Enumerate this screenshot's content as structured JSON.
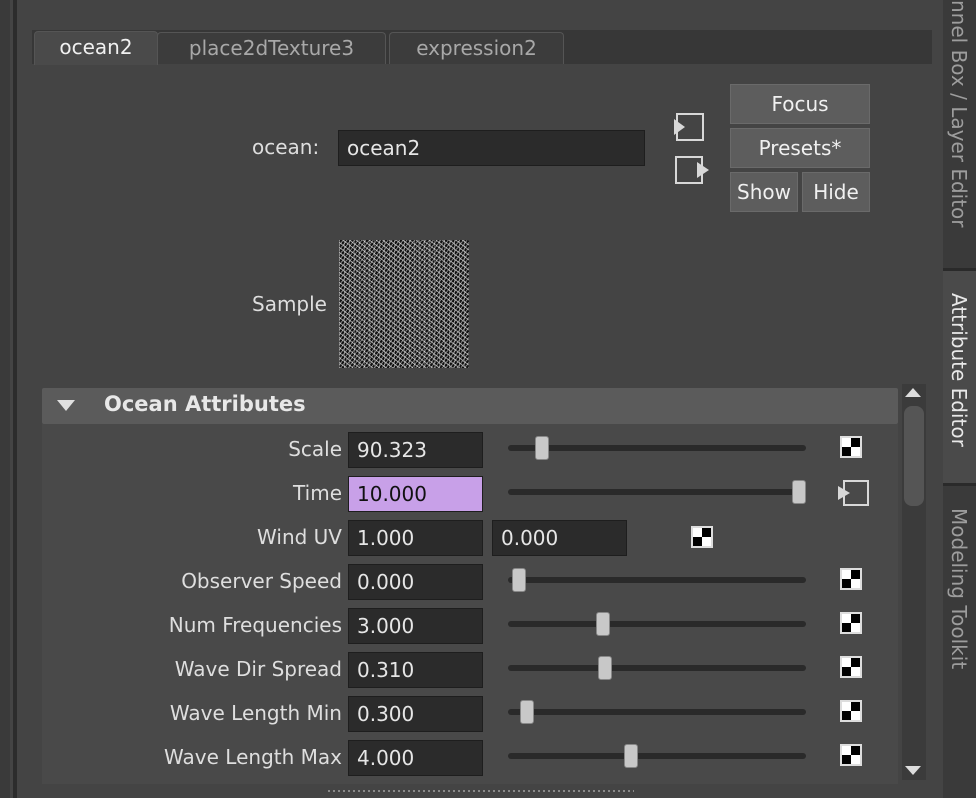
{
  "tabs": [
    {
      "label": "ocean2",
      "active": true
    },
    {
      "label": "place2dTexture3",
      "active": false
    },
    {
      "label": "expression2",
      "active": false
    }
  ],
  "node": {
    "type_label": "ocean:",
    "name_value": "ocean2"
  },
  "buttons": {
    "focus": "Focus",
    "presets": "Presets*",
    "show": "Show",
    "hide": "Hide"
  },
  "sample_label": "Sample",
  "section": {
    "title": "Ocean Attributes",
    "expanded": true
  },
  "attributes": [
    {
      "label": "Scale",
      "value": "90.323",
      "slider_fraction": 0.12,
      "map_icon": "checker-icon"
    },
    {
      "label": "Time",
      "value": "10.000",
      "slider_fraction": 0.98,
      "map_icon": "connected-input-icon",
      "highlight": "#c8a0e8"
    },
    {
      "label": "Wind UV",
      "value": "1.000",
      "value2": "0.000",
      "map_icon": "checker-icon"
    },
    {
      "label": "Observer Speed",
      "value": "0.000",
      "slider_fraction": 0.02,
      "map_icon": "checker-icon"
    },
    {
      "label": "Num Frequencies",
      "value": "3.000",
      "slider_fraction": 0.32,
      "map_icon": "checker-icon"
    },
    {
      "label": "Wave Dir Spread",
      "value": "0.310",
      "slider_fraction": 0.33,
      "map_icon": "checker-icon"
    },
    {
      "label": "Wave Length Min",
      "value": "0.300",
      "slider_fraction": 0.06,
      "map_icon": "checker-icon"
    },
    {
      "label": "Wave Length Max",
      "value": "4.000",
      "slider_fraction": 0.41,
      "map_icon": "checker-icon"
    }
  ],
  "dock_tabs": [
    {
      "label": "nnel Box / Layer Editor",
      "active": false
    },
    {
      "label": "Attribute Editor",
      "active": true
    },
    {
      "label": "Modeling Toolkit",
      "active": false
    }
  ]
}
